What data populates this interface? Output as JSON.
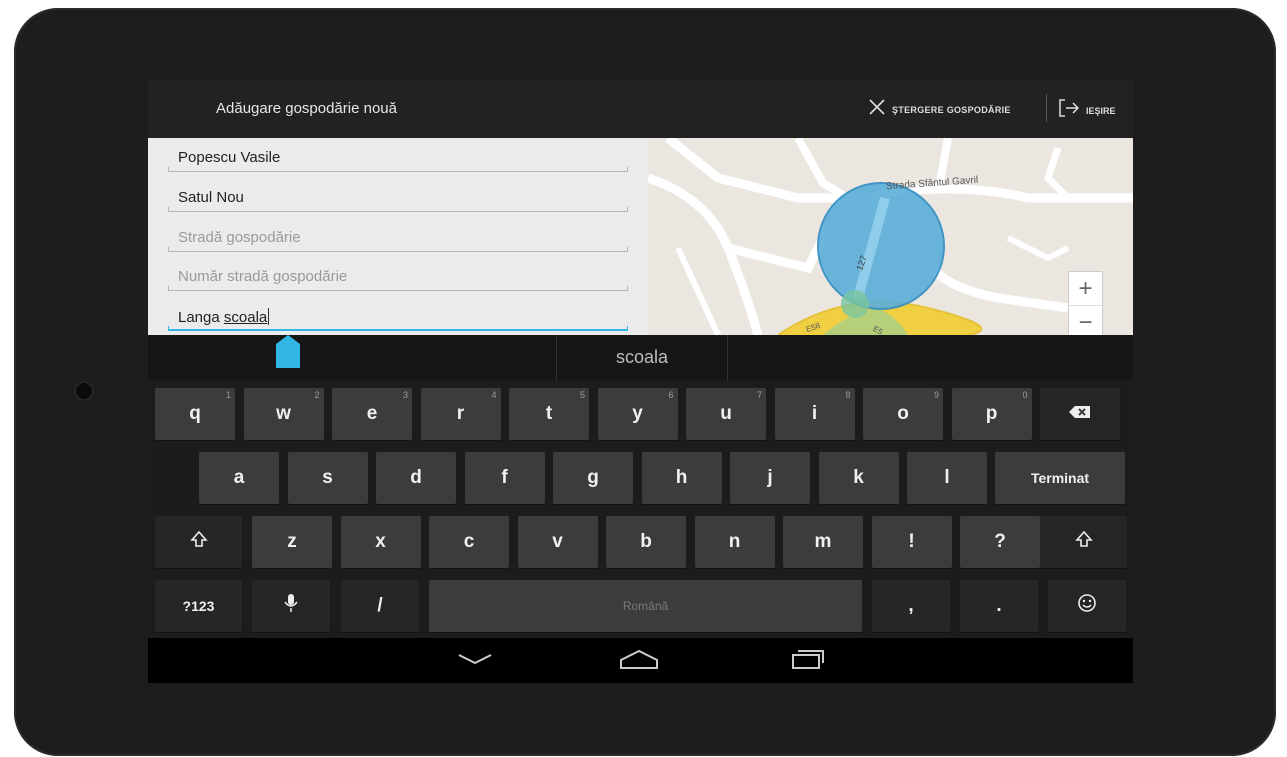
{
  "actionbar": {
    "title": "Adăugare gospodărie nouă",
    "delete_label": "ŞTERGERE GOSPODĂRIE",
    "exit_label": "IEŞIRE"
  },
  "form": {
    "fields": [
      {
        "value": "Popescu Vasile",
        "placeholder": ""
      },
      {
        "value": "Satul Nou",
        "placeholder": ""
      },
      {
        "value": "",
        "placeholder": "Stradă gospodărie"
      },
      {
        "value": "",
        "placeholder": "Număr stradă gospodărie"
      },
      {
        "value_prefix": "Langa ",
        "value_word": "scoala"
      }
    ]
  },
  "map": {
    "street_label": "Strada Sfântul Gavril",
    "road_label_1": "E58",
    "road_label_2": "E5",
    "road_label_3": "127",
    "zoom_in": "+",
    "zoom_out": "−",
    "accent": "#33b5e5"
  },
  "keyboard": {
    "suggestion": "scoala",
    "row1": [
      {
        "l": "q",
        "h": "1"
      },
      {
        "l": "w",
        "h": "2"
      },
      {
        "l": "e",
        "h": "3"
      },
      {
        "l": "r",
        "h": "4"
      },
      {
        "l": "t",
        "h": "5"
      },
      {
        "l": "y",
        "h": "6"
      },
      {
        "l": "u",
        "h": "7"
      },
      {
        "l": "i",
        "h": "8"
      },
      {
        "l": "o",
        "h": "9"
      },
      {
        "l": "p",
        "h": "0"
      }
    ],
    "row2": [
      "a",
      "s",
      "d",
      "f",
      "g",
      "h",
      "j",
      "k",
      "l"
    ],
    "row3": [
      "z",
      "x",
      "c",
      "v",
      "b",
      "n",
      "m",
      "!",
      "?"
    ],
    "done_label": "Terminat",
    "sym_label": "?123",
    "slash_label": "/",
    "space_label": "Română",
    "comma_label": ",",
    "period_label": ".",
    "icons": [
      "backspace-icon",
      "shift-icon",
      "mic-icon",
      "emoji-icon"
    ]
  },
  "navbar": {
    "icons": [
      "back-icon",
      "home-icon",
      "recents-icon"
    ]
  }
}
